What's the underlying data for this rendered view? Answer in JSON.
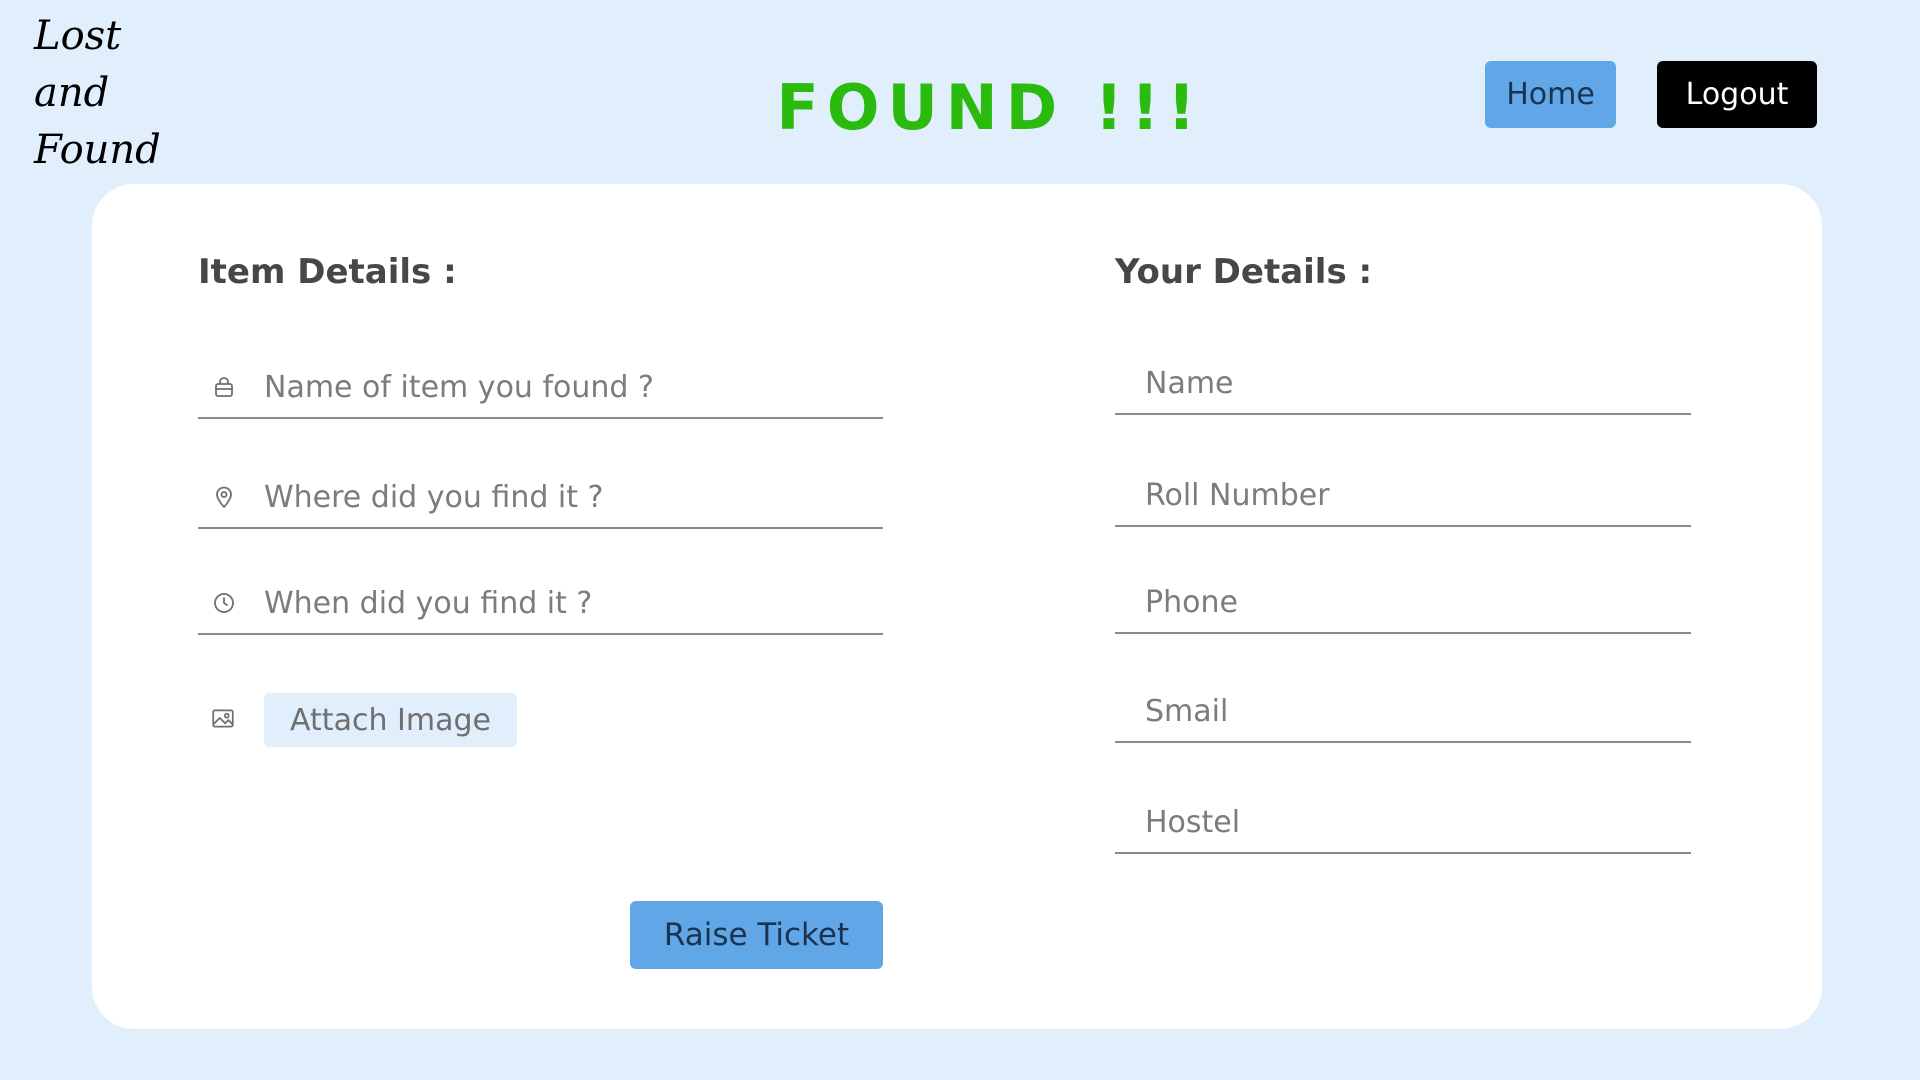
{
  "logo": {
    "line1": "Lost",
    "line2": "and",
    "line3": "Found"
  },
  "header": {
    "title": "FOUND !!!",
    "home_label": "Home",
    "logout_label": "Logout"
  },
  "item_details": {
    "heading": "Item Details :",
    "name_placeholder": "Name of item you found ?",
    "where_placeholder": "Where did you find it ?",
    "when_placeholder": "When did you find it ?",
    "attach_label": "Attach Image",
    "submit_label": "Raise Ticket"
  },
  "your_details": {
    "heading": "Your Details :",
    "name_placeholder": "Name",
    "roll_placeholder": "Roll Number",
    "phone_placeholder": "Phone",
    "email_placeholder": "Smail",
    "hostel_placeholder": "Hostel"
  },
  "colors": {
    "background": "#e1effd",
    "title_green": "#2bbb0f",
    "button_blue": "#61a7e7",
    "logout_black": "#000000"
  },
  "icons": {
    "item_name": "bag-icon",
    "location": "map-pin-icon",
    "time": "clock-icon",
    "image": "image-icon"
  }
}
